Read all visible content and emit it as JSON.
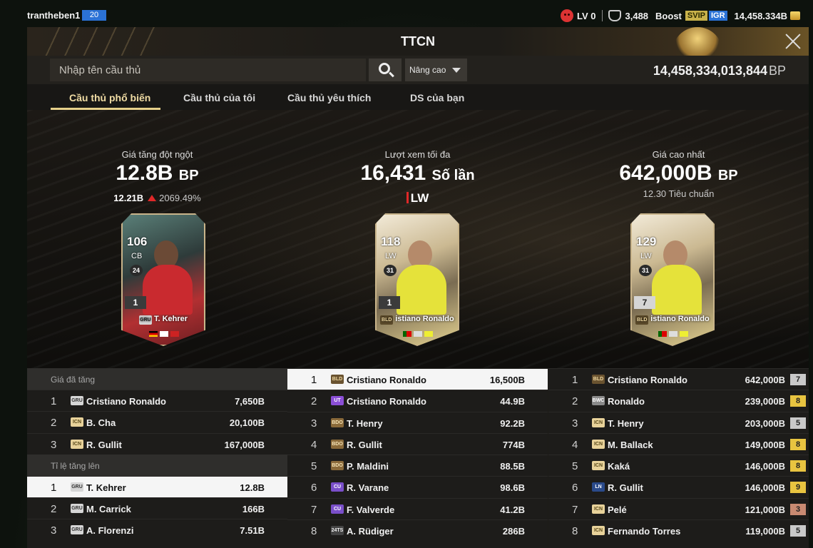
{
  "topbar": {
    "username": "trantheben1",
    "user_level": "20",
    "lv": "LV 0",
    "shield_count": "3,488",
    "boost_label": "Boost",
    "svip": "SVIP",
    "igr": "IGR",
    "bp_short": "14,458.334B"
  },
  "panel": {
    "title": "TTCN",
    "search_placeholder": "Nhập tên cầu thủ",
    "advanced_label": "Nâng cao",
    "bp_total": "14,458,334,013,844",
    "bp_unit": "BP"
  },
  "tabs": [
    {
      "label": "Cầu thủ phổ biến"
    },
    {
      "label": "Cầu thủ của tôi"
    },
    {
      "label": "Cầu thủ yêu thích"
    },
    {
      "label": "DS của bạn"
    }
  ],
  "highlights": [
    {
      "label": "Giá tăng đột ngột",
      "value": "12.8B",
      "unit": "BP",
      "sub_value": "12.21B",
      "sub_pct": "2069.49%",
      "card": {
        "ovr": "106",
        "pos": "CB",
        "season_num": "24",
        "grade": "1",
        "season": "GRU",
        "name": "T. Kehrer"
      }
    },
    {
      "label": "Lượt xem tối đa",
      "value": "16,431",
      "unit": "Số lần",
      "position": "LW",
      "card": {
        "ovr": "118",
        "pos": "LW",
        "season_num": "31",
        "grade": "1",
        "season": "BLD",
        "name": "istiano Ronaldo"
      }
    },
    {
      "label": "Giá cao nhất",
      "value": "642,000B",
      "unit": "BP",
      "sub_text": "12.30 Tiêu chuẩn",
      "card": {
        "ovr": "129",
        "pos": "LW",
        "season_num": "31",
        "grade": "7",
        "season": "BLD",
        "name": "istiano Ronaldo"
      }
    }
  ],
  "table_left": {
    "section1": "Giá đã tăng",
    "rows1": [
      {
        "rank": "1",
        "season": "GRU",
        "name": "Cristiano Ronaldo",
        "value": "7,650B"
      },
      {
        "rank": "2",
        "season": "ICN",
        "name": "B. Cha",
        "value": "20,100B"
      },
      {
        "rank": "3",
        "season": "ICN",
        "name": "R. Gullit",
        "value": "167,000B"
      }
    ],
    "section2": "Tỉ lệ tăng lên",
    "rows2": [
      {
        "rank": "1",
        "season": "GRU",
        "name": "T. Kehrer",
        "value": "12.8B"
      },
      {
        "rank": "2",
        "season": "GRU",
        "name": "M. Carrick",
        "value": "166B"
      },
      {
        "rank": "3",
        "season": "GRU",
        "name": "A. Florenzi",
        "value": "7.51B"
      }
    ]
  },
  "table_mid": {
    "rows": [
      {
        "rank": "1",
        "season": "BLD",
        "name": "Cristiano Ronaldo",
        "value": "16,500B"
      },
      {
        "rank": "2",
        "season": "UT",
        "name": "Cristiano Ronaldo",
        "value": "44.9B"
      },
      {
        "rank": "3",
        "season": "BDO",
        "name": "T. Henry",
        "value": "92.2B"
      },
      {
        "rank": "4",
        "season": "BDO",
        "name": "R. Gullit",
        "value": "774B"
      },
      {
        "rank": "5",
        "season": "BDO",
        "name": "P. Maldini",
        "value": "88.5B"
      },
      {
        "rank": "6",
        "season": "CU",
        "name": "R. Varane",
        "value": "98.6B"
      },
      {
        "rank": "7",
        "season": "CU",
        "name": "F. Valverde",
        "value": "41.2B"
      },
      {
        "rank": "8",
        "season": "24TS",
        "name": "A. Rüdiger",
        "value": "286B"
      }
    ]
  },
  "table_right": {
    "rows": [
      {
        "rank": "1",
        "season": "BLD",
        "name": "Cristiano Ronaldo",
        "value": "642,000B",
        "grade": "7"
      },
      {
        "rank": "2",
        "season": "BWC",
        "name": "Ronaldo",
        "value": "239,000B",
        "grade": "8"
      },
      {
        "rank": "3",
        "season": "ICN",
        "name": "T. Henry",
        "value": "203,000B",
        "grade": "5"
      },
      {
        "rank": "4",
        "season": "ICN",
        "name": "M. Ballack",
        "value": "149,000B",
        "grade": "8"
      },
      {
        "rank": "5",
        "season": "ICN",
        "name": "Kaká",
        "value": "146,000B",
        "grade": "8"
      },
      {
        "rank": "6",
        "season": "LN",
        "name": "R. Gullit",
        "value": "146,000B",
        "grade": "9"
      },
      {
        "rank": "7",
        "season": "ICN",
        "name": "Pelé",
        "value": "121,000B",
        "grade": "3"
      },
      {
        "rank": "8",
        "season": "ICN",
        "name": "Fernando Torres",
        "value": "119,000B",
        "grade": "5"
      }
    ]
  },
  "colors": {
    "accent_gold": "#e6d08a",
    "up_red": "#e02828",
    "grade_gold": "#e8c440",
    "grade_silver": "#c9c9c9",
    "grade_bronze": "#c98a72"
  }
}
